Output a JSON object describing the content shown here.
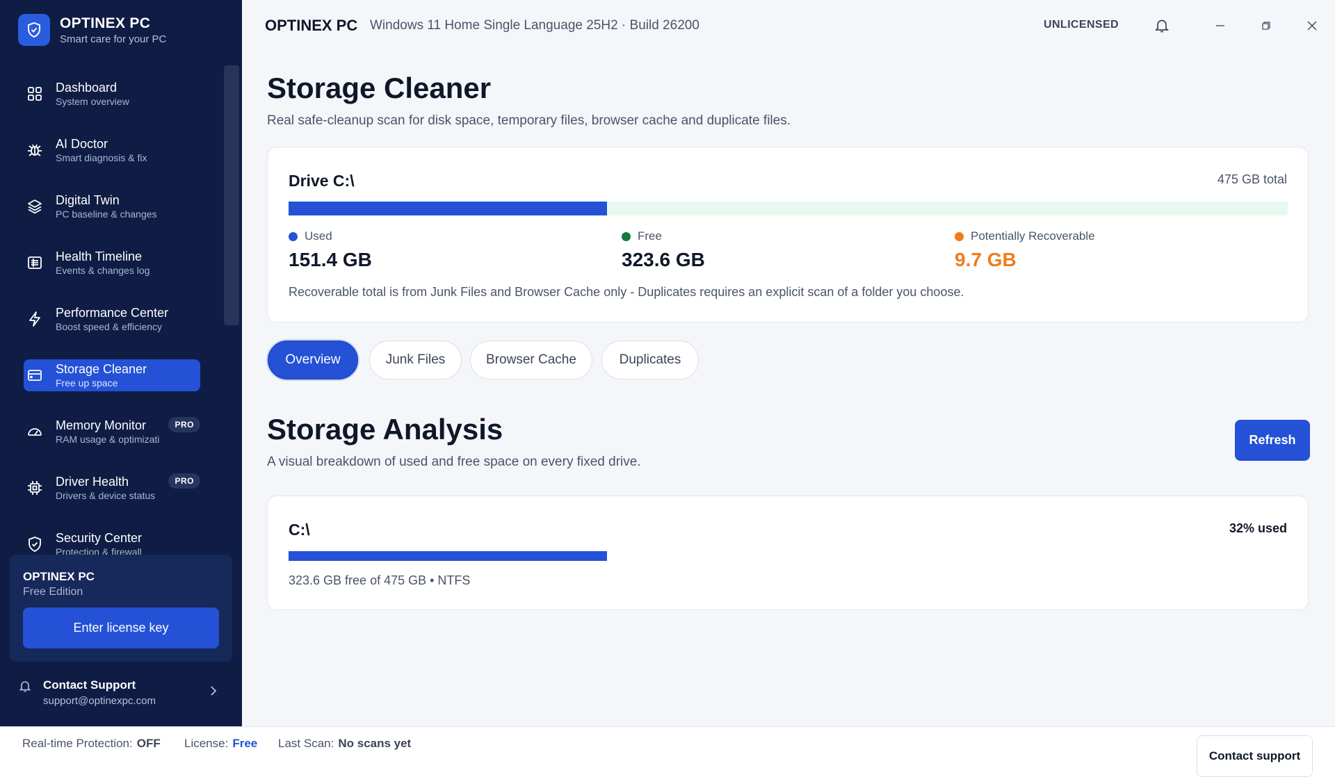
{
  "brand": {
    "name": "OPTINEX PC",
    "tagline": "Smart care for your PC"
  },
  "sidebar": {
    "items": [
      {
        "label": "Dashboard",
        "sub": "System overview",
        "icon": "grid-icon"
      },
      {
        "label": "AI Doctor",
        "sub": "Smart diagnosis & fix",
        "icon": "bug-icon"
      },
      {
        "label": "Digital Twin",
        "sub": "PC baseline & changes",
        "icon": "layers-icon"
      },
      {
        "label": "Health Timeline",
        "sub": "Events & changes log",
        "icon": "list-icon"
      },
      {
        "label": "Performance Center",
        "sub": "Boost speed & efficiency",
        "icon": "bolt-icon"
      },
      {
        "label": "Storage Cleaner",
        "sub": "Free up space",
        "icon": "drive-icon",
        "active": true
      },
      {
        "label": "Memory Monitor",
        "sub": "RAM usage & optimizati",
        "icon": "gauge-icon",
        "badge": "PRO"
      },
      {
        "label": "Driver Health",
        "sub": "Drivers & device status",
        "icon": "chip-icon",
        "badge": "PRO"
      },
      {
        "label": "Security Center",
        "sub": "Protection & firewall",
        "icon": "shield-icon"
      }
    ]
  },
  "license_card": {
    "title": "OPTINEX PC",
    "edition": "Free Edition",
    "button": "Enter license key"
  },
  "support": {
    "title": "Contact Support",
    "email": "support@optinexpc.com"
  },
  "topbar": {
    "app_title": "OPTINEX PC",
    "os_info": "Windows 11 Home Single Language 25H2  ·  Build 26200",
    "status": "UNLICENSED"
  },
  "page": {
    "title": "Storage Cleaner",
    "subtitle": "Real safe-cleanup scan for disk space, temporary files, browser cache and duplicate files."
  },
  "drive": {
    "name": "Drive C:\\",
    "total": "475 GB total",
    "used_fraction": 0.3187,
    "used_label": "Used",
    "used_value": "151.4 GB",
    "used_color": "#2451d6",
    "free_label": "Free",
    "free_value": "323.6 GB",
    "free_color": "#137a3e",
    "recover_label": "Potentially Recoverable",
    "recover_value": "9.7 GB",
    "recover_color": "#f07c1a",
    "note": "Recoverable total is from Junk Files and Browser Cache only - Duplicates requires an explicit scan of a folder you choose."
  },
  "tabs": [
    {
      "label": "Overview",
      "active": true
    },
    {
      "label": "Junk Files"
    },
    {
      "label": "Browser Cache"
    },
    {
      "label": "Duplicates"
    }
  ],
  "analysis": {
    "title": "Storage Analysis",
    "subtitle": "A visual breakdown of used and free space on every fixed drive.",
    "refresh": "Refresh",
    "drives": [
      {
        "name": "C:\\",
        "used_pct_label": "32% used",
        "used_fraction": 0.32,
        "detail": "323.6 GB free of 475 GB • NTFS"
      }
    ]
  },
  "footer": {
    "protection_label": "Real-time Protection:",
    "protection_value": "OFF",
    "license_label": "License:",
    "license_value": "Free",
    "scan_label": "Last Scan:",
    "scan_value": "No scans yet",
    "button": "Contact support"
  }
}
